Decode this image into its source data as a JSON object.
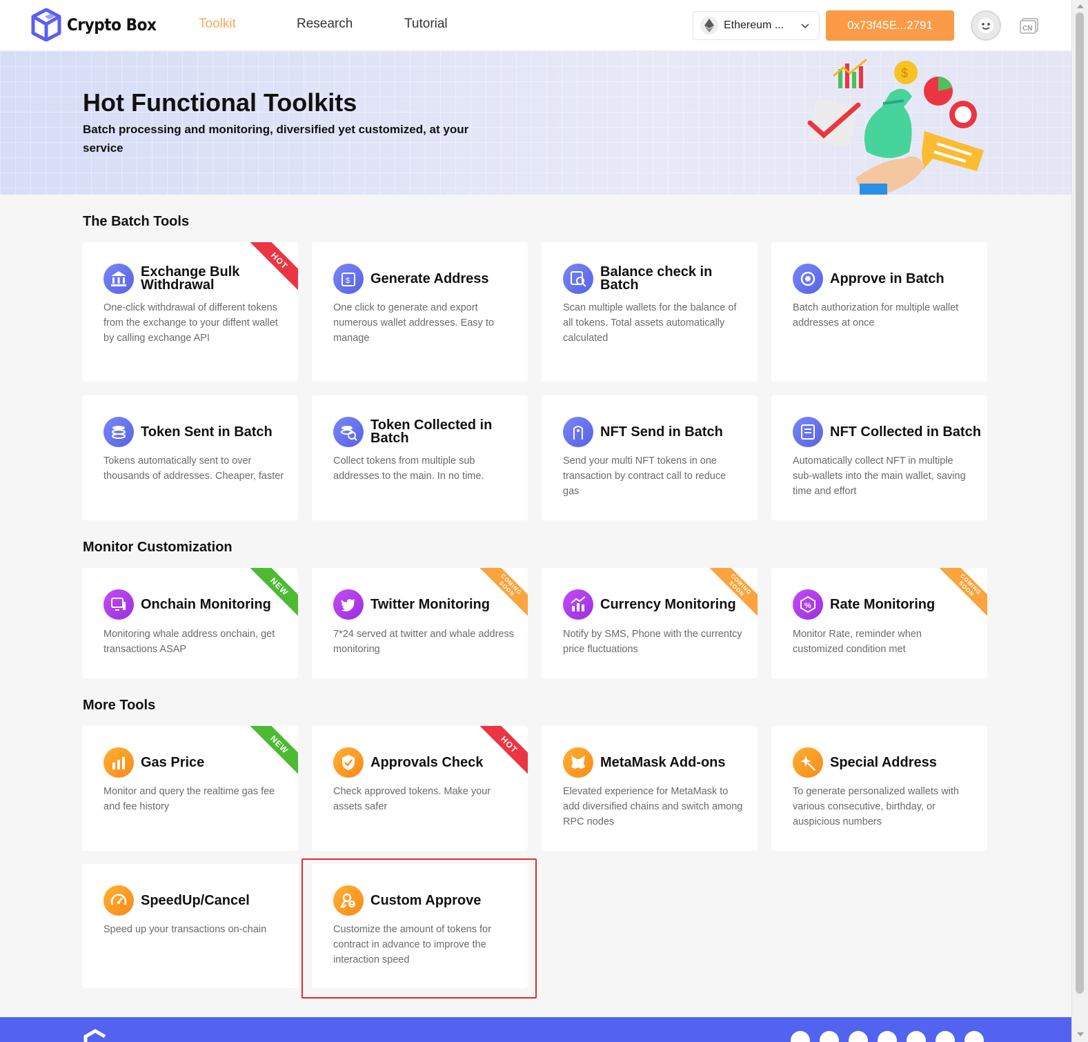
{
  "header": {
    "brand": "Crypto Box",
    "nav": [
      {
        "label": "Toolkit",
        "active": true
      },
      {
        "label": "Research",
        "active": false
      },
      {
        "label": "Tutorial",
        "active": false
      }
    ],
    "network": "Ethereum ...",
    "wallet": "0x73f45E...2791",
    "language": "CN"
  },
  "banner": {
    "title": "Hot Functional Toolkits",
    "subtitle": "Batch processing and monitoring, diversified yet customized, at your service"
  },
  "sections": {
    "batch": {
      "title": "The Batch Tools",
      "cards": [
        {
          "title": "Exchange Bulk Withdrawal",
          "desc": "One-click withdrawal of different tokens from the exchange to your diffent wallet by calling exchange API",
          "badge": "HOT",
          "icon": "bank-icon"
        },
        {
          "title": "Generate Address",
          "desc": "One click to generate and export numerous wallet addresses. Easy to manage",
          "icon": "wallet-icon"
        },
        {
          "title": "Balance check in Batch",
          "desc": "Scan multiple wallets for the balance of all tokens. Total assets automatically calculated",
          "icon": "scan-icon"
        },
        {
          "title": "Approve in Batch",
          "desc": "Batch authorization for multiple wallet addresses at once",
          "icon": "approve-icon"
        },
        {
          "title": "Token Sent in Batch",
          "desc": "Tokens automatically sent to over thousands of addresses. Cheaper, faster",
          "icon": "coins-icon"
        },
        {
          "title": "Token Collected in Batch",
          "desc": "Collect tokens from multiple sub addresses to the main. In no time.",
          "icon": "collect-icon"
        },
        {
          "title": "NFT Send in Batch",
          "desc": "Send your multi NFT tokens in one transaction by contract call to reduce gas",
          "icon": "nft-send-icon"
        },
        {
          "title": "NFT Collected in Batch",
          "desc": "Automatically collect NFT in multiple sub-wallets into the main wallet, saving time and effort",
          "icon": "nft-collect-icon"
        }
      ]
    },
    "monitor": {
      "title": "Monitor Customization",
      "cards": [
        {
          "title": "Onchain Monitoring",
          "desc": "Monitoring whale address onchain, get transactions ASAP",
          "badge": "NEW",
          "icon": "monitor-icon"
        },
        {
          "title": "Twitter Monitoring",
          "desc": "7*24 served at twitter and whale address monitoring",
          "badge": "COMING SOON",
          "icon": "twitter-icon"
        },
        {
          "title": "Currency Monitoring",
          "desc": "Notify by SMS, Phone with the currentcy price fluctuations",
          "badge": "COMING SOON",
          "icon": "chart-icon"
        },
        {
          "title": "Rate Monitoring",
          "desc": "Monitor Rate, reminder when customized condition met",
          "badge": "COMING SOON",
          "icon": "rate-icon"
        }
      ]
    },
    "more": {
      "title": "More Tools",
      "cards": [
        {
          "title": "Gas Price",
          "desc": "Monitor and query the realtime gas fee and fee history",
          "badge": "NEW",
          "icon": "bar-chart-icon"
        },
        {
          "title": "Approvals Check",
          "desc": "Check approved tokens. Make your assets safer",
          "badge": "HOT",
          "icon": "shield-check-icon"
        },
        {
          "title": "MetaMask Add-ons",
          "desc": "Elevated experience for MetaMask to add diversified chains and switch among RPC nodes",
          "icon": "metamask-icon"
        },
        {
          "title": "Special Address",
          "desc": "To generate personalized wallets with various consecutive, birthday, or auspicious numbers",
          "icon": "sparkle-icon"
        },
        {
          "title": "SpeedUp/Cancel",
          "desc": "Speed up your transactions on-chain",
          "icon": "speedometer-icon"
        },
        {
          "title": "Custom Approve",
          "desc": "Customize the amount of tokens for contract in advance to improve the interaction speed",
          "icon": "key-user-icon"
        }
      ]
    }
  },
  "colors": {
    "accent": "#fb9b47",
    "hot": "#ec3542",
    "new": "#4cbb33",
    "soon": "#fba33c",
    "highlight": "#e02a2a"
  }
}
